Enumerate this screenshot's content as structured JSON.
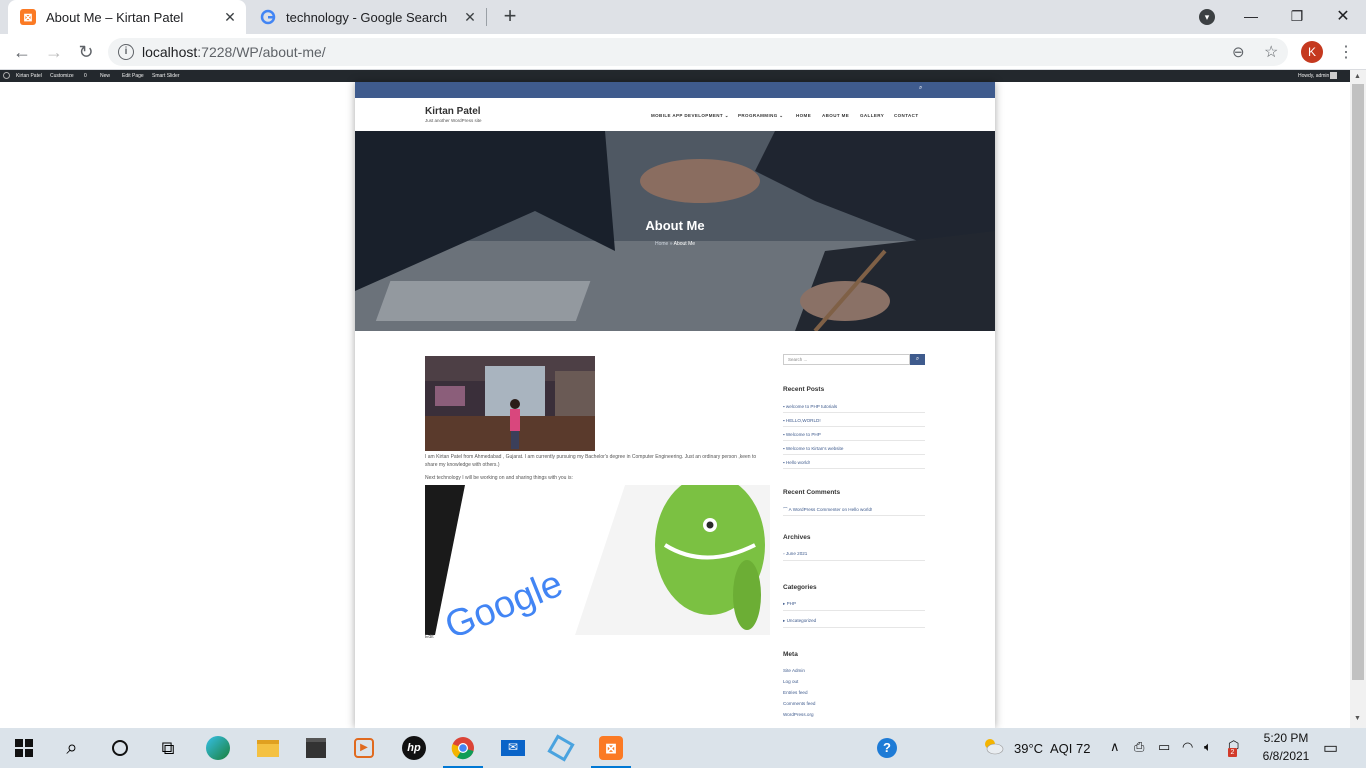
{
  "browser": {
    "tabs": [
      {
        "title": "About Me – Kirtan Patel",
        "active": true
      },
      {
        "title": "technology - Google Search",
        "active": false
      }
    ],
    "new_tab": "+",
    "url_host": "localhost",
    "url_rest": ":7228/WP/about-me/",
    "profile_initial": "K"
  },
  "adminbar": {
    "items": [
      "Kirtan Patel",
      "Customize",
      "0",
      "New",
      "Edit Page",
      "Smart Slider"
    ],
    "greeting": "Howdy, admin"
  },
  "site": {
    "title": "Kirtan Patel",
    "tagline": "Just another WordPress site",
    "menu": [
      "MOBILE APP DEVELOPMENT ⌄",
      "PROGRAMMING ⌄",
      "HOME",
      "ABOUT ME",
      "GALLERY",
      "CONTACT"
    ]
  },
  "hero": {
    "title": "About Me",
    "crumb_home": "Home",
    "crumb_current": "About Me"
  },
  "content": {
    "para1": "I am Kirtan Patel from Ahmedabad , Gujarat. I am currently pursuing my Bachelor's degree in Computer Engineering. Just an ordinary person ,keen to share my knowledge with others.)",
    "para2": "Next technology I will be working on and sharing things with you is:",
    "edit": "Edit"
  },
  "sidebar": {
    "search_placeholder": "Search ...",
    "recent_posts_title": "Recent Posts",
    "recent_posts": [
      "welcome to PHP tutorials",
      "HELLO,WORLD!",
      "Welcome to PHP",
      "Welcome to Kirtan's website",
      "Hello world!"
    ],
    "recent_comments_title": "Recent Comments",
    "recent_comments": [
      "A WordPress Commenter on Hello world!"
    ],
    "archives_title": "Archives",
    "archives": [
      "June 2021"
    ],
    "categories_title": "Categories",
    "categories": [
      "PHP",
      "Uncategorized"
    ],
    "meta_title": "Meta",
    "meta": [
      "Site Admin",
      "Log out",
      "Entries feed",
      "Comments feed",
      "WordPress.org"
    ]
  },
  "taskbar": {
    "weather": "39°C",
    "aqi": "AQI 72",
    "time": "5:20 PM",
    "date": "6/8/2021",
    "badge": "2"
  },
  "colors": {
    "accent": "#3f5b8d",
    "adminbar": "#23282d",
    "tabstrip": "#dee1e6"
  }
}
